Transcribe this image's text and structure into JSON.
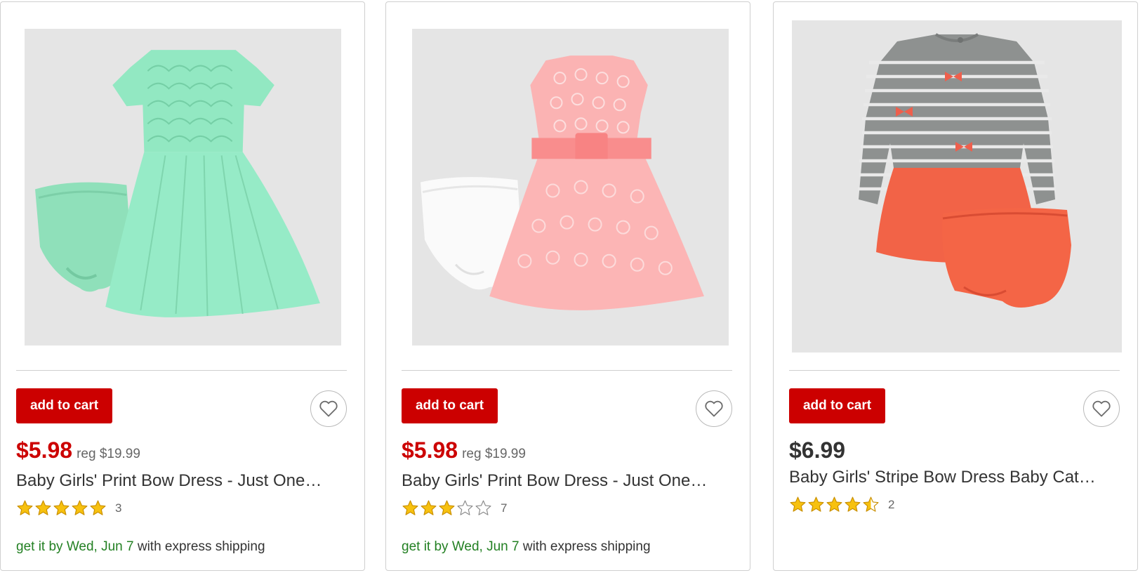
{
  "products": [
    {
      "add_to_cart_label": "add to cart",
      "price": "$5.98",
      "reg_price": "reg $19.99",
      "title": "Baby Girls' Print Bow Dress - Just One…",
      "rating": 5,
      "review_count": "3",
      "ship_date": "get it by Wed, Jun 7",
      "ship_suffix": " with express shipping",
      "image": "mint-green-lace-tulle-dress-with-bloomers"
    },
    {
      "add_to_cart_label": "add to cart",
      "price": "$5.98",
      "reg_price": "reg $19.99",
      "title": "Baby Girls' Print Bow Dress - Just One…",
      "rating": 3,
      "review_count": "7",
      "ship_date": "get it by Wed, Jun 7",
      "ship_suffix": " with express shipping",
      "image": "pink-lace-dress-with-bow-and-white-bloomers"
    },
    {
      "add_to_cart_label": "add to cart",
      "price": "$6.99",
      "reg_price": "",
      "title": "Baby Girls' Stripe Bow Dress Baby Cat…",
      "rating": 4.5,
      "review_count": "2",
      "ship_date": "",
      "ship_suffix": "",
      "image": "gray-stripe-top-coral-skirt-dress-with-bloomers"
    }
  ],
  "colors": {
    "brand_red": "#cc0000",
    "star_gold": "#f7c10f",
    "ship_green": "#238023",
    "image_bg": "#e5e5e5"
  },
  "icons": {
    "favorite": "heart-outline-icon",
    "star": "star-icon"
  }
}
